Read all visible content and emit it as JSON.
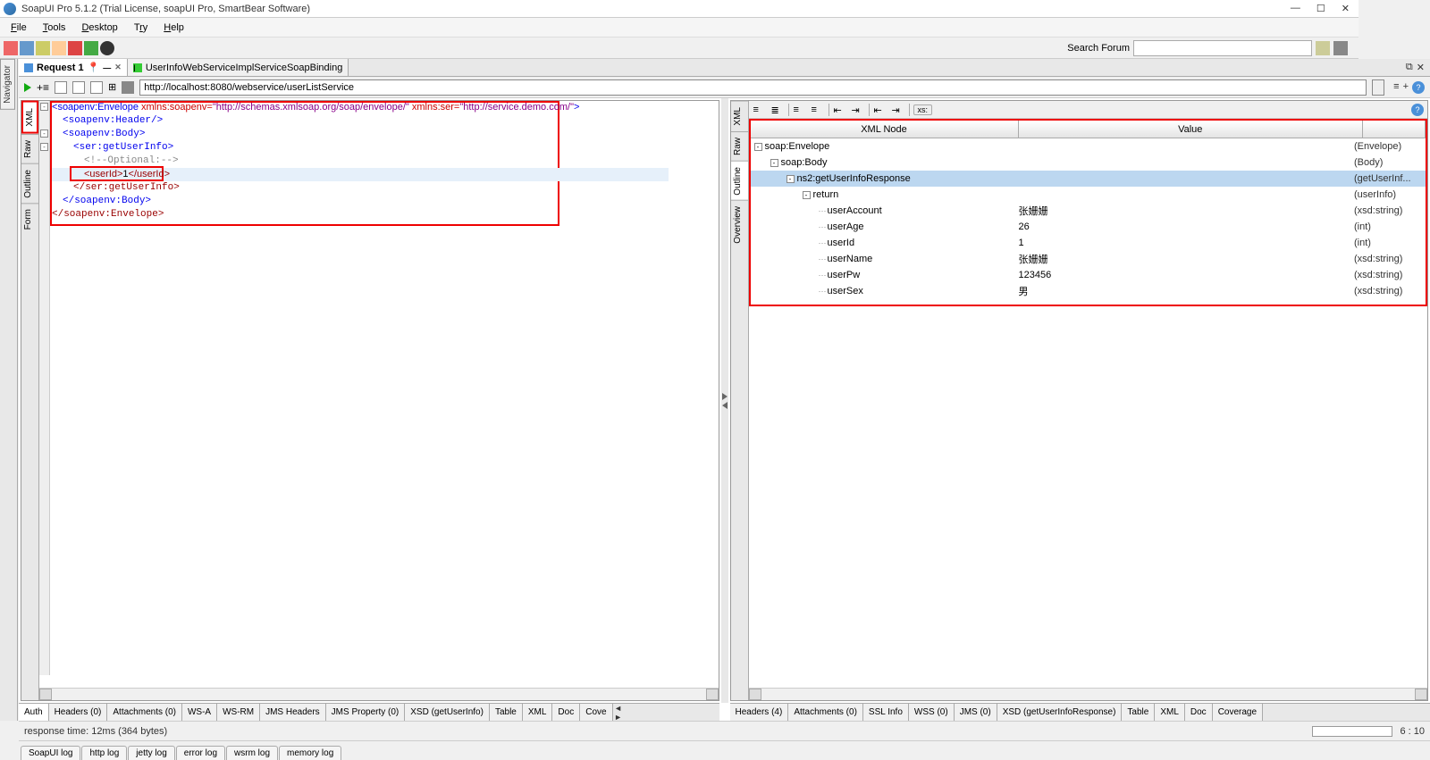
{
  "title": "SoapUI Pro 5.1.2 (Trial License, soapUI Pro, SmartBear Software)",
  "menu": [
    "File",
    "Tools",
    "Desktop",
    "Try",
    "Help"
  ],
  "searchForumLabel": "Search Forum",
  "navigatorTab": "Navigator",
  "tabs": [
    {
      "label": "Request 1",
      "active": true,
      "pin": "📌"
    },
    {
      "label": "UserInfoWebServiceImplServiceSoapBinding",
      "active": false
    }
  ],
  "url": "http://localhost:8080/webservice/userListService",
  "leftVTabs": [
    "XML",
    "Raw",
    "Outline",
    "Form"
  ],
  "rightVTabs": [
    "XML",
    "Raw",
    "Outline",
    "Overview"
  ],
  "xml": {
    "l1a": "soapenv:Envelope",
    "l1_attr1n": " xmlns:soapenv=",
    "l1_attr1v": "\"http://schemas.xmlsoap.org/soap/envelope/\"",
    "l1_attr2n": " xmlns:ser=",
    "l1_attr2v": "\"http://service.demo.com/\"",
    "l2": "<soapenv:Header/>",
    "l3": "<soapenv:Body>",
    "l4": "<ser:getUserInfo>",
    "l5": "<!--Optional:-->",
    "l6a": "<userId>",
    "l6b": "1",
    "l6c": "</userId>",
    "l7": "</ser:getUserInfo>",
    "l8": "</soapenv:Body>",
    "l9": "</soapenv:Envelope>"
  },
  "respHeaders": {
    "c1": "XML Node",
    "c2": "Value",
    "c3": ""
  },
  "respRows": [
    {
      "indent": 0,
      "toggle": "-",
      "dots": "",
      "name": "soap:Envelope",
      "val": "",
      "type": "(Envelope)",
      "sel": false
    },
    {
      "indent": 1,
      "toggle": "-",
      "dots": "",
      "name": "soap:Body",
      "val": "",
      "type": "(Body)",
      "sel": false
    },
    {
      "indent": 2,
      "toggle": "-",
      "dots": "",
      "name": "ns2:getUserInfoResponse",
      "val": "",
      "type": "(getUserInf...",
      "sel": true
    },
    {
      "indent": 3,
      "toggle": "-",
      "dots": "",
      "name": "return",
      "val": "",
      "type": "(userInfo)",
      "sel": false
    },
    {
      "indent": 4,
      "toggle": "",
      "dots": "…",
      "name": "userAccount",
      "val": "张姗姗",
      "type": "(xsd:string)",
      "sel": false
    },
    {
      "indent": 4,
      "toggle": "",
      "dots": "…",
      "name": "userAge",
      "val": "26",
      "type": "(int)",
      "sel": false
    },
    {
      "indent": 4,
      "toggle": "",
      "dots": "…",
      "name": "userId",
      "val": "1",
      "type": "(int)",
      "sel": false
    },
    {
      "indent": 4,
      "toggle": "",
      "dots": "…",
      "name": "userName",
      "val": "张姗姗",
      "type": "(xsd:string)",
      "sel": false
    },
    {
      "indent": 4,
      "toggle": "",
      "dots": "…",
      "name": "userPw",
      "val": "123456",
      "type": "(xsd:string)",
      "sel": false
    },
    {
      "indent": 4,
      "toggle": "",
      "dots": "…",
      "name": "userSex",
      "val": "男",
      "type": "(xsd:string)",
      "sel": false
    }
  ],
  "leftBTabs": [
    "Auth",
    "Headers (0)",
    "Attachments (0)",
    "WS-A",
    "WS-RM",
    "JMS Headers",
    "JMS Property (0)",
    "XSD (getUserInfo)",
    "Table",
    "XML",
    "Doc",
    "Cove"
  ],
  "rightBTabs": [
    "Headers (4)",
    "Attachments (0)",
    "SSL Info",
    "WSS (0)",
    "JMS (0)",
    "XSD (getUserInfoResponse)",
    "Table",
    "XML",
    "Doc",
    "Coverage"
  ],
  "statusText": "response time: 12ms (364 bytes)",
  "cursorPos": "6 : 10",
  "logTabs": [
    "SoapUI log",
    "http log",
    "jetty log",
    "error log",
    "wsrm log",
    "memory log"
  ],
  "xsBtn": "xs:"
}
